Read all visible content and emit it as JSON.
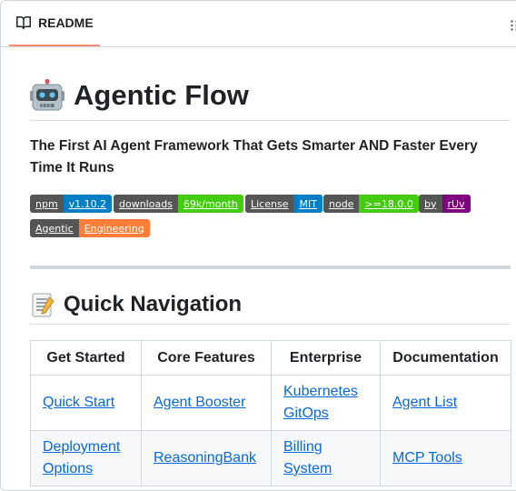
{
  "tab": {
    "label": "README",
    "icon": "book-icon"
  },
  "readme": {
    "title": "Agentic Flow",
    "title_icon": "robot-emoji",
    "tagline": "The First AI Agent Framework That Gets Smarter AND Faster Every Time It Runs",
    "badges": [
      {
        "left": "npm",
        "right": "v1.10.2",
        "color": "#007ec6"
      },
      {
        "left": "downloads",
        "right": "69k/month",
        "color": "#4c1"
      },
      {
        "left": "License",
        "right": "MIT",
        "color": "#007ec6"
      },
      {
        "left": "node",
        "right": ">=18.0.0",
        "color": "#4c1"
      },
      {
        "left": "by",
        "right": "rUv",
        "color": "#800080"
      },
      {
        "left": "Agentic",
        "right": "Engineering",
        "color": "#fe7d37"
      }
    ],
    "section_title": "Quick Navigation",
    "section_icon": "memo-emoji",
    "table": {
      "headers": [
        "Get Started",
        "Core Features",
        "Enterprise",
        "Documentation"
      ],
      "rows": [
        [
          "Quick Start",
          "Agent Booster",
          "Kubernetes GitOps",
          "Agent List"
        ],
        [
          "Deployment Options",
          "ReasoningBank",
          "Billing System",
          "MCP Tools"
        ]
      ]
    }
  }
}
